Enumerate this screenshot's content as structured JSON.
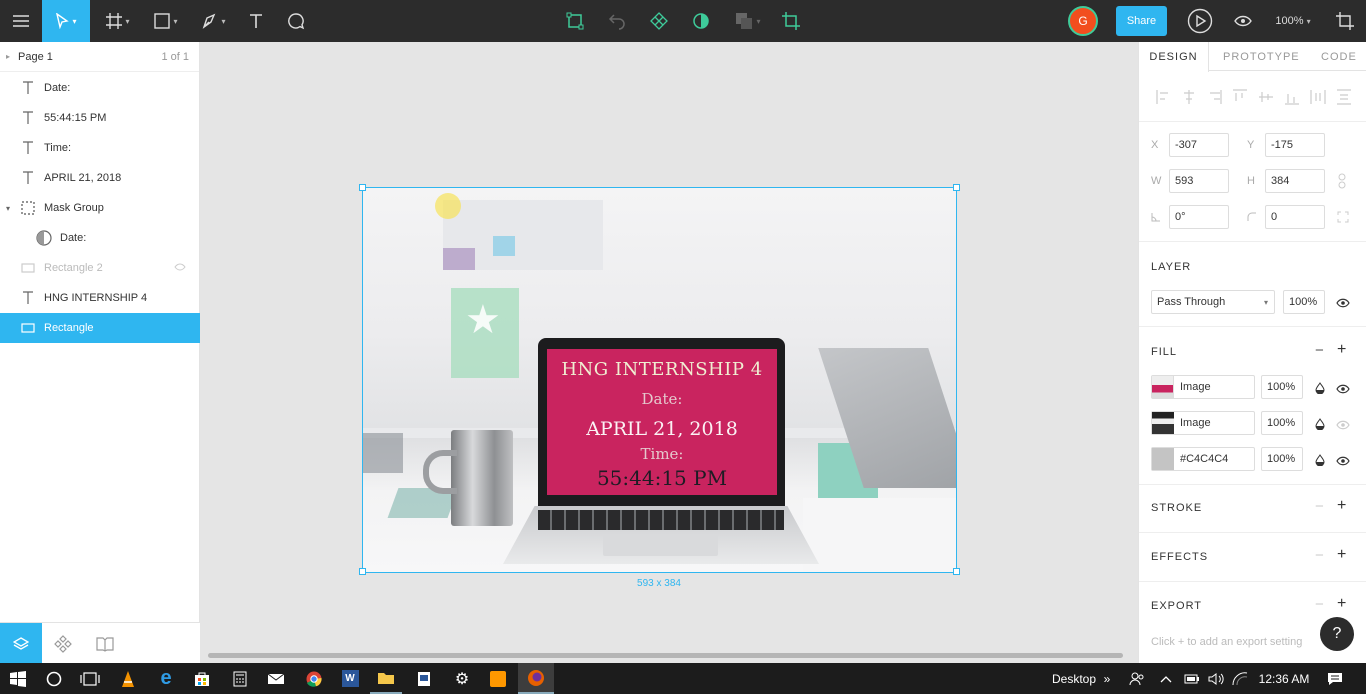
{
  "toolbar": {
    "share_label": "Share",
    "avatar_initial": "G",
    "zoom": "100%"
  },
  "layers": {
    "page_name": "Page 1",
    "page_count": "1 of 1",
    "items": [
      {
        "label": "Date:"
      },
      {
        "label": "55:44:15 PM"
      },
      {
        "label": "Time:"
      },
      {
        "label": "APRIL 21, 2018"
      },
      {
        "label": "Mask Group"
      },
      {
        "label": "Date:"
      },
      {
        "label": "Rectangle 2"
      },
      {
        "label": "HNG INTERNSHIP 4"
      },
      {
        "label": "Rectangle"
      }
    ]
  },
  "canvas": {
    "screen_title": "HNG INTERNSHIP 4",
    "screen_date_label": "Date:",
    "screen_date": "APRIL 21, 2018",
    "screen_time_label": "Time:",
    "screen_time": "55:44:15 PM",
    "size_label": "593 x 384",
    "accent": "#c9245f"
  },
  "design": {
    "tabs": [
      "DESIGN",
      "PROTOTYPE",
      "CODE"
    ],
    "x_label": "X",
    "x": "-307",
    "y_label": "Y",
    "y": "-175",
    "w_label": "W",
    "w": "593",
    "h_label": "H",
    "h": "384",
    "rotation": "0°",
    "radius": "0",
    "layer_title": "LAYER",
    "blend_mode": "Pass Through",
    "layer_opacity": "100%",
    "fill_title": "FILL",
    "fills": [
      {
        "name": "Image",
        "opacity": "100%"
      },
      {
        "name": "Image",
        "opacity": "100%"
      },
      {
        "name": "#C4C4C4",
        "opacity": "100%"
      }
    ],
    "stroke_title": "STROKE",
    "effects_title": "EFFECTS",
    "export_title": "EXPORT",
    "export_hint": "Click + to add an export setting",
    "help": "?"
  },
  "taskbar": {
    "desktop_label": "Desktop",
    "time": "12:36 AM"
  }
}
